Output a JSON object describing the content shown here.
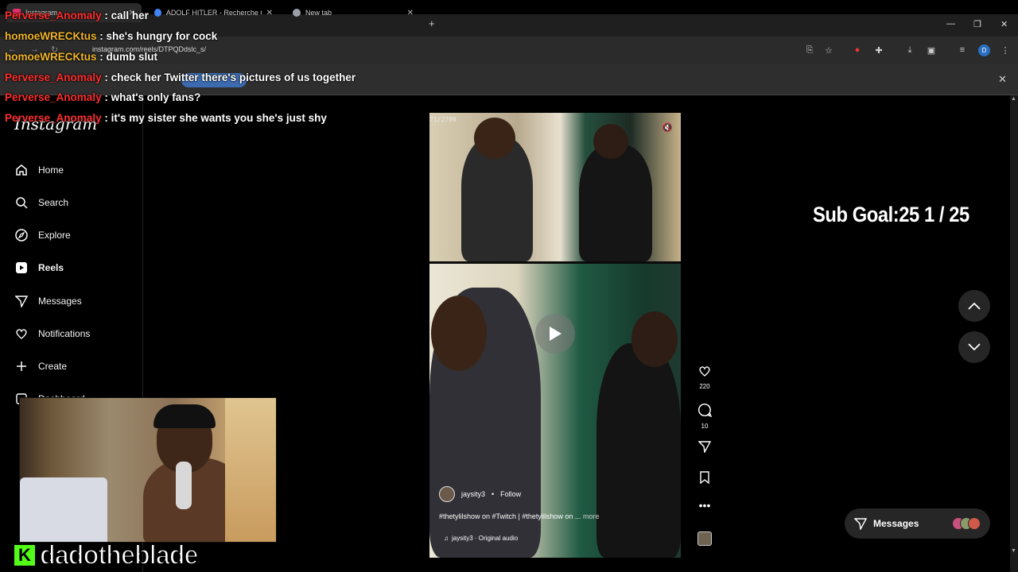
{
  "browser": {
    "tabs": [
      {
        "title": "Instagram",
        "favicon_color": "#e1306c",
        "active": true
      },
      {
        "title": "ADOLF HITLER - Recherche Goo",
        "favicon_color": "#4285f4",
        "active": false
      },
      {
        "title": "New tab",
        "favicon_color": "#9aa0a6",
        "active": false
      }
    ],
    "url": "instagram.com/reels/DTPQDdslc_s/",
    "profile_initial": "D"
  },
  "instagram": {
    "logo": "Instagram",
    "nav": [
      {
        "label": "Home",
        "icon": "home-icon"
      },
      {
        "label": "Search",
        "icon": "search-icon"
      },
      {
        "label": "Explore",
        "icon": "compass-icon"
      },
      {
        "label": "Reels",
        "icon": "reels-icon"
      },
      {
        "label": "Messages",
        "icon": "messages-icon"
      },
      {
        "label": "Notifications",
        "icon": "heart-icon"
      },
      {
        "label": "Create",
        "icon": "plus-icon"
      },
      {
        "label": "Dashboard",
        "icon": "dashboard-icon"
      }
    ],
    "reel": {
      "counter": "71/2700",
      "username": "jaysity3",
      "follow": "Follow",
      "caption": "#thetylilshow on #Twitch | #thetylilshow on ...",
      "more": "more",
      "audio": "jaysity3 · Original audio",
      "likes": "220",
      "comments": "10"
    },
    "messages_label": "Messages"
  },
  "overlay": {
    "sub_goal": "Sub Goal:25  1 / 25",
    "streamer_name": "dadotheblade",
    "chat": [
      {
        "user": "Perverse_Anomaly",
        "color": "#ff2e2e",
        "message": ": call her"
      },
      {
        "user": "homoeWRECKtus",
        "color": "#f0b52a",
        "message": ": she's hungry for cock"
      },
      {
        "user": "homoeWRECKtus",
        "color": "#f0b52a",
        "message": ": dumb slut"
      },
      {
        "user": "Perverse_Anomaly",
        "color": "#ff2e2e",
        "message": ": check her Twitter there's pictures of us together"
      },
      {
        "user": "Perverse_Anomaly",
        "color": "#ff2e2e",
        "message": ": what's only fans?"
      },
      {
        "user": "Perverse_Anomaly",
        "color": "#ff2e2e",
        "message": ": it's my sister she wants you she's just shy"
      }
    ]
  }
}
